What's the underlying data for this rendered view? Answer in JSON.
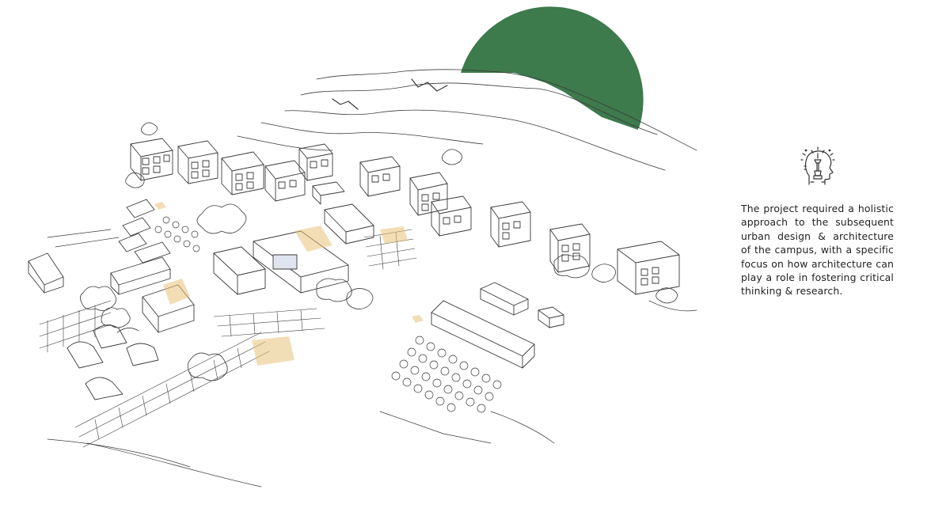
{
  "colors": {
    "accent_green": "#3d7a4c",
    "sketch_ink": "#3a3a3a",
    "sketch_wash": "#e8c27a",
    "background": "#ffffff"
  },
  "icon": {
    "name": "head-with-idea-icon"
  },
  "description": {
    "text": "The project required a holistic approach to the subsequent urban design & architecture of the campus, with a specific focus on how architecture can play a role in fostering critical thinking & research."
  }
}
